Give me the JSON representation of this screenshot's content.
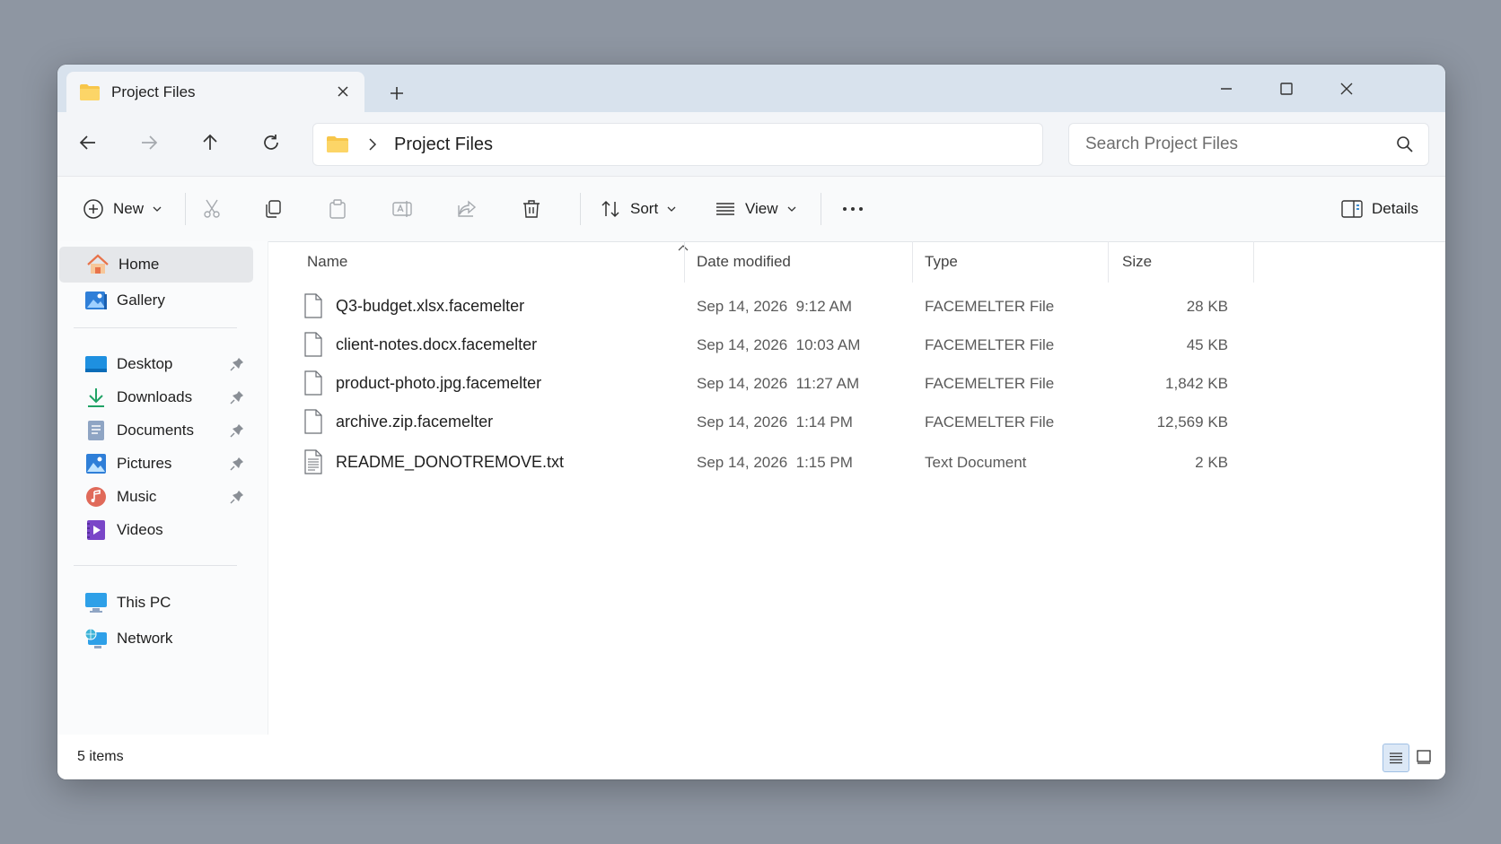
{
  "tab": {
    "title": "Project Files"
  },
  "address": {
    "path": "Project Files"
  },
  "search": {
    "placeholder": "Search Project Files"
  },
  "commands": {
    "new_label": "New",
    "sort_label": "Sort",
    "view_label": "View",
    "details_label": "Details"
  },
  "sidebar": {
    "top": [
      {
        "label": "Home",
        "icon": "home-icon"
      },
      {
        "label": "Gallery",
        "icon": "gallery-icon"
      }
    ],
    "pinned": [
      {
        "label": "Desktop",
        "icon": "desktop-icon"
      },
      {
        "label": "Downloads",
        "icon": "download-icon"
      },
      {
        "label": "Documents",
        "icon": "documents-icon"
      },
      {
        "label": "Pictures",
        "icon": "pictures-icon"
      },
      {
        "label": "Music",
        "icon": "music-icon"
      },
      {
        "label": "Videos",
        "icon": "videos-icon"
      }
    ],
    "bottom": [
      {
        "label": "This PC",
        "icon": "computer-icon"
      },
      {
        "label": "Network",
        "icon": "network-icon"
      }
    ]
  },
  "columns": {
    "name": "Name",
    "date": "Date modified",
    "type": "Type",
    "size": "Size"
  },
  "files": [
    {
      "name": "Q3-budget.xlsx.facemelter",
      "date": "Sep 14, 2026",
      "time": "9:12 AM",
      "type": "FACEMELTER File",
      "size": "28 KB"
    },
    {
      "name": "client-notes.docx.facemelter",
      "date": "Sep 14, 2026",
      "time": "10:03 AM",
      "type": "FACEMELTER File",
      "size": "45 KB"
    },
    {
      "name": "product-photo.jpg.facemelter",
      "date": "Sep 14, 2026",
      "time": "11:27 AM",
      "type": "FACEMELTER File",
      "size": "1,842 KB"
    },
    {
      "name": "archive.zip.facemelter",
      "date": "Sep 14, 2026",
      "time": "1:14 PM",
      "type": "FACEMELTER File",
      "size": "12,569 KB"
    },
    {
      "name": "README_DONOTREMOVE.txt",
      "date": "Sep 14, 2026",
      "time": "1:15 PM",
      "type": "Text Document",
      "size": "2 KB"
    }
  ],
  "status": {
    "item_count": "5 items"
  },
  "colors": {
    "folder": "#f7c64a",
    "accent": "#0067c0",
    "titlebar": "#d8e2ed"
  }
}
